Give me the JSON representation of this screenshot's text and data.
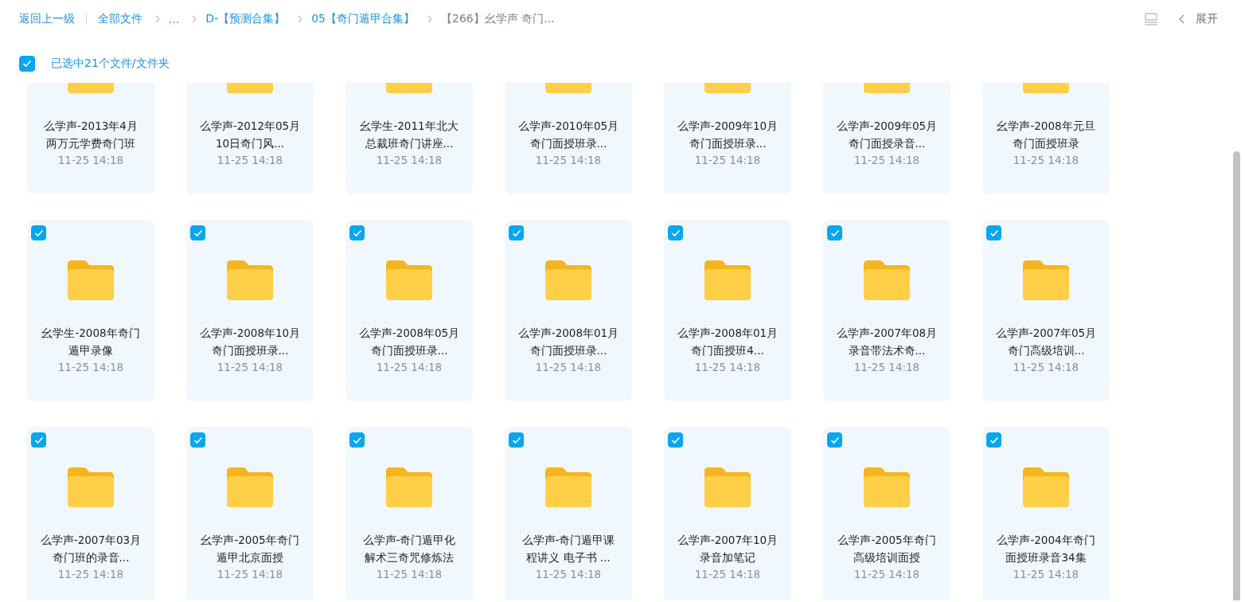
{
  "toolbar": {
    "back": "返回上一级",
    "breadcrumbs": [
      {
        "label": "全部文件",
        "current": false
      },
      {
        "label": "...",
        "current": false
      },
      {
        "label": "D-【预测合集】",
        "current": false
      },
      {
        "label": "05【奇门遁甲合集】",
        "current": false
      },
      {
        "label": "【266】幺学声 奇门...",
        "current": true
      }
    ],
    "expand": "展开"
  },
  "selection": {
    "checked": true,
    "label": "已选中21个文件/文件夹"
  },
  "files": [
    {
      "name": "么学声-2013年4月两万元学费奇门班",
      "time": "11-25 14:18"
    },
    {
      "name": "么学声-2012年05月10日奇门风...",
      "time": "11-25 14:18"
    },
    {
      "name": "幺学生-2011年北大总裁班奇门讲座...",
      "time": "11-25 14:18"
    },
    {
      "name": "么学声-2010年05月奇门面授班录...",
      "time": "11-25 14:18"
    },
    {
      "name": "么学声-2009年10月奇门面授班录...",
      "time": "11-25 14:18"
    },
    {
      "name": "么学声-2009年05月奇门面授录音...",
      "time": "11-25 14:18"
    },
    {
      "name": "幺学声-2008年元旦奇门面授班录",
      "time": "11-25 14:18"
    },
    {
      "name": "幺学生-2008年奇门遁甲录像",
      "time": "11-25 14:18",
      "selected": true
    },
    {
      "name": "么学声-2008年10月奇门面授班录...",
      "time": "11-25 14:18",
      "selected": true
    },
    {
      "name": "么学声-2008年05月奇门面授班录...",
      "time": "11-25 14:18",
      "selected": true
    },
    {
      "name": "么学声-2008年01月奇门面授班录...",
      "time": "11-25 14:18",
      "selected": true
    },
    {
      "name": "么学声-2008年01月奇门面授班4...",
      "time": "11-25 14:18",
      "selected": true
    },
    {
      "name": "么学声-2007年08月录音带法术奇...",
      "time": "11-25 14:18",
      "selected": true
    },
    {
      "name": "么学声-2007年05月奇门高级培训...",
      "time": "11-25 14:18",
      "selected": true
    },
    {
      "name": "么学声-2007年03月奇门班的录音...",
      "time": "11-25 14:18",
      "selected": true
    },
    {
      "name": "幺学声-2005年奇门遁甲北京面授",
      "time": "11-25 14:18",
      "selected": true
    },
    {
      "name": "么学声-奇门遁甲化解术三奇咒修炼法",
      "time": "11-25 14:18",
      "selected": true
    },
    {
      "name": "么学声-奇门遁甲课程讲义 电子书 ...",
      "time": "11-25 14:18",
      "selected": true
    },
    {
      "name": "么学声-2007年10月录音加笔记",
      "time": "11-25 14:18",
      "selected": true
    },
    {
      "name": "么学声-2005年奇门高级培训面授",
      "time": "11-25 14:18",
      "selected": true
    },
    {
      "name": "么学声-2004年奇门面授班录音34集",
      "time": "11-25 14:18",
      "selected": true
    }
  ]
}
